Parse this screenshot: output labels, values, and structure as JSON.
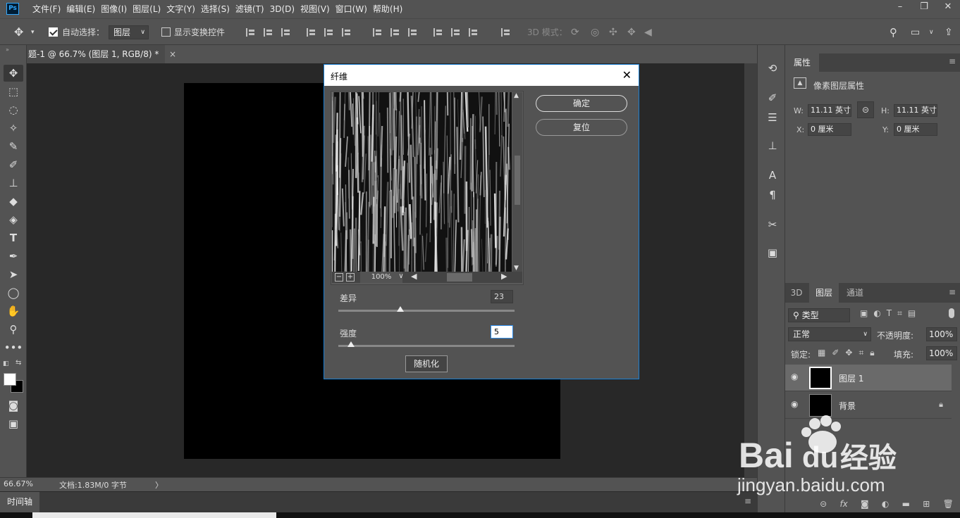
{
  "app": {
    "logo": "Ps"
  },
  "menu": [
    "文件(F)",
    "编辑(E)",
    "图像(I)",
    "图层(L)",
    "文字(Y)",
    "选择(S)",
    "滤镜(T)",
    "3D(D)",
    "视图(V)",
    "窗口(W)",
    "帮助(H)"
  ],
  "options_bar": {
    "auto_select_label": "自动选择：",
    "auto_select_target": "图层",
    "show_transform_label": "显示变换控件",
    "mode_3d_label": "3D 模式："
  },
  "document": {
    "tab_title": "题-1 @ 66.7% (图层 1, RGB/8) *",
    "tab_close": "×"
  },
  "status": {
    "zoom": "66.67%",
    "doc_size": "文档:1.83M/0 字节",
    "arrow": "〉"
  },
  "timeline": {
    "label": "时间轴"
  },
  "properties": {
    "title": "属性",
    "subtitle": "像素图层属性",
    "w_label": "W:",
    "w_value": "11.11 英寸",
    "h_label": "H:",
    "h_value": "11.11 英寸",
    "x_label": "X:",
    "x_value": "0 厘米",
    "y_label": "Y:",
    "y_value": "0 厘米"
  },
  "layers_panel": {
    "tabs": [
      "3D",
      "图层",
      "通道"
    ],
    "filter_kind": "类型",
    "blend_mode": "正常",
    "opacity_label": "不透明度:",
    "opacity_value": "100%",
    "lock_label": "锁定:",
    "fill_label": "填充:",
    "fill_value": "100%",
    "layers": [
      {
        "name": "图层 1",
        "selected": true
      },
      {
        "name": "背景",
        "locked": true
      }
    ]
  },
  "dialog": {
    "title": "纤维",
    "ok_label": "确定",
    "reset_label": "复位",
    "zoom_level": "100%",
    "variance_label": "差异",
    "variance_value": "23",
    "variance_fraction": 0.35,
    "strength_label": "强度",
    "strength_value": "5",
    "strength_fraction": 0.07,
    "randomize_label": "随机化"
  },
  "watermark": {
    "brand": "Bai",
    "brand_tail": "du",
    "site_name": "经验",
    "url": "jingyan.baidu.com"
  },
  "colors": {
    "accent": "#1a7fd3",
    "panel": "#535353",
    "canvas_bg": "#282828",
    "baidu_watermark": "#ffffff"
  }
}
